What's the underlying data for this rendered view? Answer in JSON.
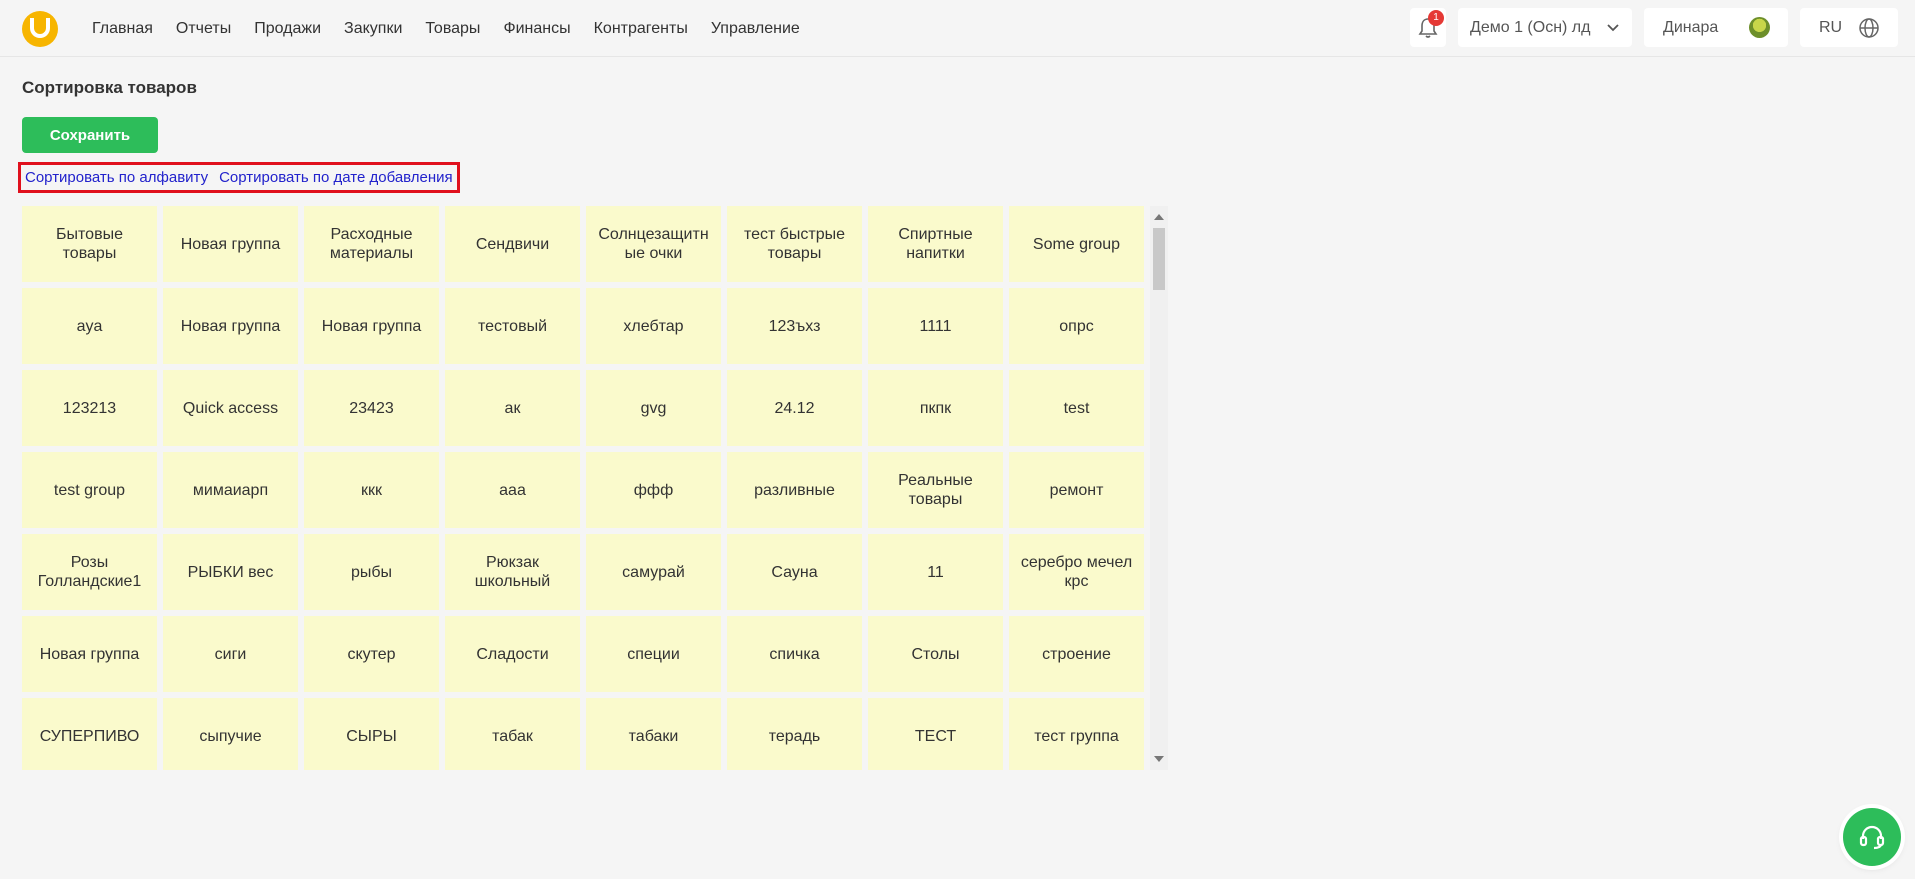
{
  "nav": [
    "Главная",
    "Отчеты",
    "Продажи",
    "Закупки",
    "Товары",
    "Финансы",
    "Контрагенты",
    "Управление"
  ],
  "notifications": {
    "count": "1"
  },
  "org": {
    "name": "Демо 1 (Осн) лд"
  },
  "user": {
    "name": "Динара"
  },
  "lang": {
    "code": "RU"
  },
  "page": {
    "title": "Сортировка товаров",
    "save_label": "Сохранить"
  },
  "sort": {
    "alpha_label": "Сортировать по алфавиту",
    "date_label": "Сортировать по дате добавления"
  },
  "groups": [
    "Бытовые товары",
    "Новая группа",
    "Расходные материалы",
    "Сендвичи",
    "Солнцезащитн ые очки",
    "тест быстрые товары",
    "Спиртные напитки",
    "Some group",
    "aya",
    "Новая группа",
    "Новая группа",
    "тестовый",
    "хлебтар",
    "123ъхз",
    "1111",
    "опрс",
    "123213",
    "Quick access",
    "23423",
    "ак",
    "gvg",
    "24.12",
    "пкпк",
    "test",
    "test group",
    "мимаиарп",
    "ккк",
    "ааа",
    "ффф",
    "разливные",
    "Реальные товары",
    "ремонт",
    "Розы Голландские1",
    "РЫБКИ вес",
    "рыбы",
    "Рюкзак школьный",
    "самурай",
    "Сауна",
    "11",
    "серебро мечел крс",
    "Новая группа",
    "сиги",
    "скутер",
    "Сладости",
    "специи",
    "спичка",
    "Столы",
    "строение",
    "СУПЕРПИВО",
    "сыпучие",
    "СЫРЫ",
    "табак",
    "табаки",
    "терадь",
    "ТЕСТ",
    "тест группа"
  ],
  "colors": {
    "accent": "#2dbd5a",
    "logo": "#f7b500",
    "tile": "#fafacc",
    "highlight": "#e0101d",
    "link": "#2222cc"
  }
}
